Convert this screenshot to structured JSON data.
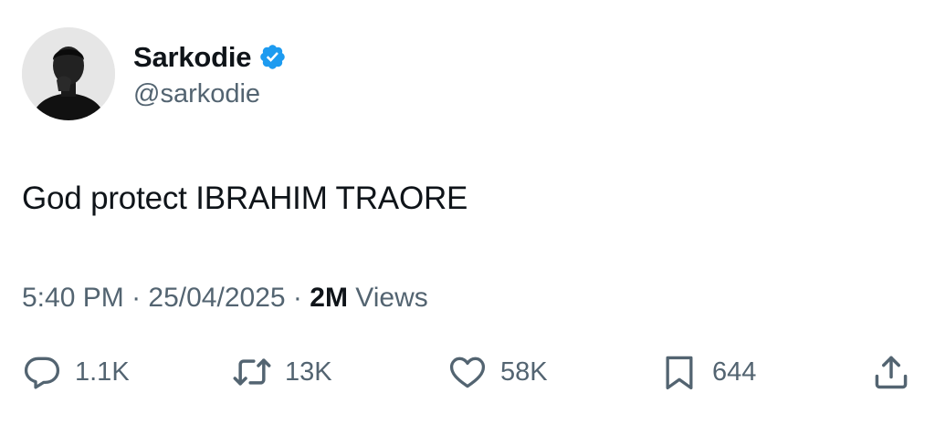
{
  "author": {
    "display_name": "Sarkodie",
    "handle": "@sarkodie",
    "verified": true,
    "verified_color": "#1d9bf0"
  },
  "tweet": {
    "text": "God protect IBRAHIM TRAORE"
  },
  "meta": {
    "time": "5:40 PM",
    "separator": "·",
    "date": "25/04/2025",
    "views_count": "2M",
    "views_label": "Views"
  },
  "actions": {
    "replies": "1.1K",
    "retweets": "13K",
    "likes": "58K",
    "bookmarks": "644"
  },
  "colors": {
    "text": "#0f1419",
    "secondary": "#536471",
    "accent": "#1d9bf0"
  },
  "icons": {
    "reply": "reply-icon",
    "retweet": "retweet-icon",
    "like": "heart-icon",
    "bookmark": "bookmark-icon",
    "share": "share-icon"
  }
}
